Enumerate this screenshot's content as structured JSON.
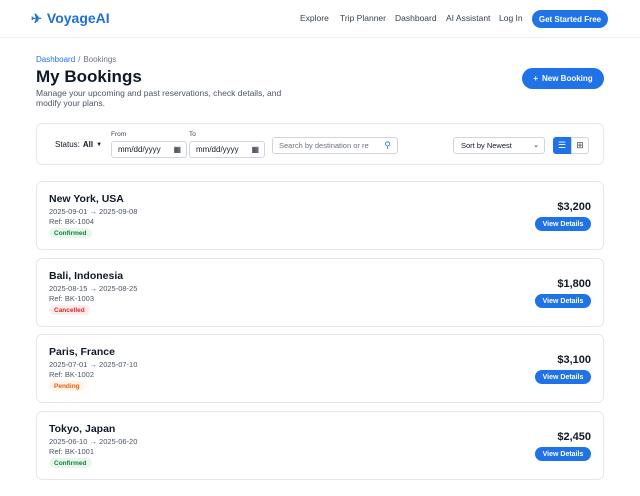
{
  "brand": {
    "name": "VoyageAI",
    "icon": "airplane-icon"
  },
  "nav": {
    "items": [
      "Explore",
      "Trip Planner",
      "Dashboard",
      "AI Assistant",
      "Log In"
    ],
    "cta": "Get Started Free"
  },
  "breadcrumb": {
    "parent": "Dashboard",
    "separator": "/",
    "current": "Bookings"
  },
  "page": {
    "title": "My Bookings",
    "subtitle": "Manage your upcoming and past reservations, check details, and modify your plans.",
    "new_button": "New Booking",
    "new_button_icon": "+"
  },
  "filters": {
    "status_label": "Status:",
    "status_value": "All",
    "from_label": "From",
    "to_label": "To",
    "from_value": "mm/dd/yyyy",
    "to_value": "mm/dd/yyyy",
    "search_placeholder": "Search by destination or reference",
    "sort_value": "Sort by Newest",
    "view_list_icon": "list-icon",
    "view_grid_icon": "grid-icon"
  },
  "bookings": [
    {
      "destination": "New York, USA",
      "dates": "2025-09-01 → 2025-09-08",
      "ref": "Ref: BK-1004",
      "status": "Confirmed",
      "price": "$3,200",
      "action": "View Details"
    },
    {
      "destination": "Bali, Indonesia",
      "dates": "2025-08-15 → 2025-08-25",
      "ref": "Ref: BK-1003",
      "status": "Cancelled",
      "price": "$1,800",
      "action": "View Details"
    },
    {
      "destination": "Paris, France",
      "dates": "2025-07-01 → 2025-07-10",
      "ref": "Ref: BK-1002",
      "status": "Pending",
      "price": "$3,100",
      "action": "View Details"
    },
    {
      "destination": "Tokyo, Japan",
      "dates": "2025-06-10 → 2025-06-20",
      "ref": "Ref: BK-1001",
      "status": "Confirmed",
      "price": "$2,450",
      "action": "View Details"
    }
  ],
  "colors": {
    "accent": "#1f73e6",
    "confirmed": "#15803d",
    "cancelled": "#dc2626",
    "pending": "#ea580c"
  }
}
